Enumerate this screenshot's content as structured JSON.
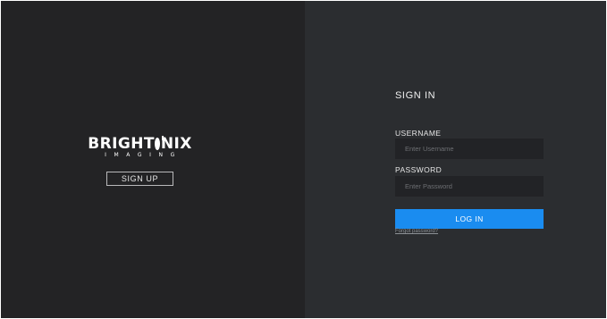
{
  "brand": {
    "logo_text": "BRIGHTONIX",
    "logo_text_before_o": "BRIGHT",
    "logo_text_after_o": "NIX",
    "logo_subtext": "IMAGING"
  },
  "left_panel": {
    "signup_label": "SIGN UP"
  },
  "login_form": {
    "title": "SIGN IN",
    "username_label": "USERNAME",
    "username_placeholder": "Enter Username",
    "username_value": "",
    "password_label": "PASSWORD",
    "password_placeholder": "Enter Password",
    "password_value": "",
    "login_label": "LOG IN",
    "forgot_label": "Forgot password?"
  },
  "colors": {
    "left_background": "#232325",
    "right_background": "#2b2d30",
    "input_background": "#222326",
    "accent": "#1a8cf0"
  }
}
